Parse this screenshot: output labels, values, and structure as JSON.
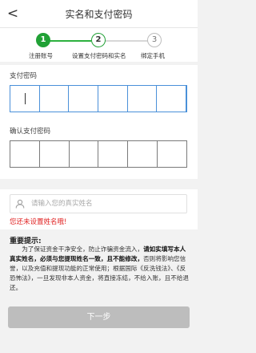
{
  "header": {
    "title": "实名和支付密码",
    "back_glyph": "<"
  },
  "steps": [
    {
      "number": "1",
      "label": "注册账号",
      "state": "done"
    },
    {
      "number": "2",
      "label": "设置支付密码和实名",
      "state": "current"
    },
    {
      "number": "3",
      "label": "绑定手机",
      "state": "pending"
    }
  ],
  "password": {
    "label": "支付密码",
    "confirm_label": "确认支付密码",
    "digits": 6
  },
  "name": {
    "placeholder": "请输入您的真实姓名",
    "value": "",
    "warning": "您还未设置姓名哦!"
  },
  "notice": {
    "title": "重要提示:",
    "text_part1": "为了保证资金干净安全，防止诈骗资金流入，",
    "text_bold": "请如实填写本人真实姓名，必须与您提现姓名一致，且不能修改，",
    "text_part2": "否则将影响您信誉，以及充值和提现功能的正常使用；根据国际《反洗钱法》、《反恐怖法》，一旦发现非本人资金，将直接冻结，不给入账，且不给退还。"
  },
  "next_button": {
    "label": "下一步"
  },
  "colors": {
    "accent": "#21a136",
    "warning": "#e02020",
    "button_disabled": "#bdbdbd",
    "input_focus": "#4a90d9"
  }
}
